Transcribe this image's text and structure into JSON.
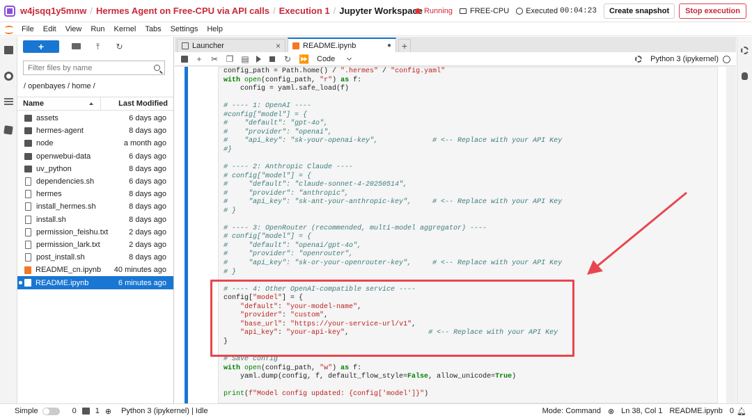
{
  "title_bar": {
    "crumbs": [
      "w4jsqq1y5mnw",
      "Hermes Agent on Free-CPU via API calls",
      "Execution 1",
      "Jupyter Workspace"
    ],
    "status": "Running",
    "plan": "FREE-CPU",
    "executed_label": "Executed",
    "executed_time": "00:04:23",
    "snapshot_button": "Create snapshot",
    "stop_button": "Stop execution"
  },
  "menu": [
    "File",
    "Edit",
    "View",
    "Run",
    "Kernel",
    "Tabs",
    "Settings",
    "Help"
  ],
  "file_browser": {
    "new_button": "+",
    "search_placeholder": "Filter files by name",
    "path": "/ openbayes / home /",
    "col_name": "Name",
    "col_modified": "Last Modified",
    "files": [
      {
        "name": "assets",
        "modified": "6 days ago",
        "icon": "folder-icon"
      },
      {
        "name": "hermes-agent",
        "modified": "8 days ago",
        "icon": "folder-icon"
      },
      {
        "name": "node",
        "modified": "a month ago",
        "icon": "folder-icon"
      },
      {
        "name": "openwebui-data",
        "modified": "6 days ago",
        "icon": "folder-icon"
      },
      {
        "name": "uv_python",
        "modified": "8 days ago",
        "icon": "folder-icon"
      },
      {
        "name": "dependencies.sh",
        "modified": "6 days ago",
        "icon": "file-icon"
      },
      {
        "name": "hermes",
        "modified": "8 days ago",
        "icon": "file-icon"
      },
      {
        "name": "install_hermes.sh",
        "modified": "8 days ago",
        "icon": "file-icon"
      },
      {
        "name": "install.sh",
        "modified": "8 days ago",
        "icon": "file-icon"
      },
      {
        "name": "permission_feishu.txt",
        "modified": "2 days ago",
        "icon": "file-icon"
      },
      {
        "name": "permission_lark.txt",
        "modified": "2 days ago",
        "icon": "file-icon"
      },
      {
        "name": "post_install.sh",
        "modified": "8 days ago",
        "icon": "file-icon"
      },
      {
        "name": "README_cn.ipynb",
        "modified": "40 minutes ago",
        "icon": "notebook-icon"
      },
      {
        "name": "README.ipynb",
        "modified": "6 minutes ago",
        "icon": "notebook-icon"
      }
    ]
  },
  "tabs": [
    {
      "label": "Launcher",
      "icon": "launcher-icon",
      "close": "×"
    },
    {
      "label": "README.ipynb",
      "icon": "notebook-icon",
      "close": "●"
    }
  ],
  "tab_add": "+",
  "notebook_toolbar": {
    "cell_type": "Code",
    "kernel": "Python 3 (ipykernel)"
  },
  "status_bar": {
    "mode_label": "Simple",
    "count_a": "0",
    "count_b": "1",
    "kernel_status": "Python 3 (ipykernel) | Idle",
    "mode": "Mode: Command",
    "cursor": "Ln 38, Col 1",
    "file": "README.ipynb",
    "notifications": "0"
  },
  "code_lines": [
    "config_path = Path.home() / \".hermes\" / \"config.yaml\"",
    "with open(config_path, \"r\") as f:",
    "    config = yaml.safe_load(f)",
    "",
    "# ---- 1: OpenAI ----",
    "#config[\"model\"] = {",
    "#    \"default\": \"gpt-4o\",",
    "#    \"provider\": \"openai\",",
    "#    \"api_key\": \"sk-your-openai-key\",             # <-- Replace with your API Key",
    "#}",
    "",
    "# ---- 2: Anthropic Claude ----",
    "# config[\"model\"] = {",
    "#     \"default\": \"claude-sonnet-4-20250514\",",
    "#     \"provider\": \"anthropic\",",
    "#     \"api_key\": \"sk-ant-your-anthropic-key\",     # <-- Replace with your API Key",
    "# }",
    "",
    "# ---- 3: OpenRouter (recommended, multi-model aggregator) ----",
    "# config[\"model\"] = {",
    "#     \"default\": \"openai/gpt-4o\",",
    "#     \"provider\": \"openrouter\",",
    "#     \"api_key\": \"sk-or-your-openrouter-key\",     # <-- Replace with your API Key",
    "# }",
    "",
    "# ---- 4: Other OpenAI-compatible service ----",
    "config[\"model\"] = {",
    "    \"default\": \"your-model-name\",",
    "    \"provider\": \"custom\",",
    "    \"base_url\": \"https://your-service-url/v1\",",
    "    \"api_key\": \"your-api-key\",                   # <-- Replace with your API Key",
    "}",
    "",
    "# Save config",
    "with open(config_path, \"w\") as f:",
    "    yaml.dump(config, f, default_flow_style=False, allow_unicode=True)",
    "",
    "print(f\"Model config updated: {config['model']}\")"
  ],
  "annotation": {
    "color": "#e8464e"
  }
}
